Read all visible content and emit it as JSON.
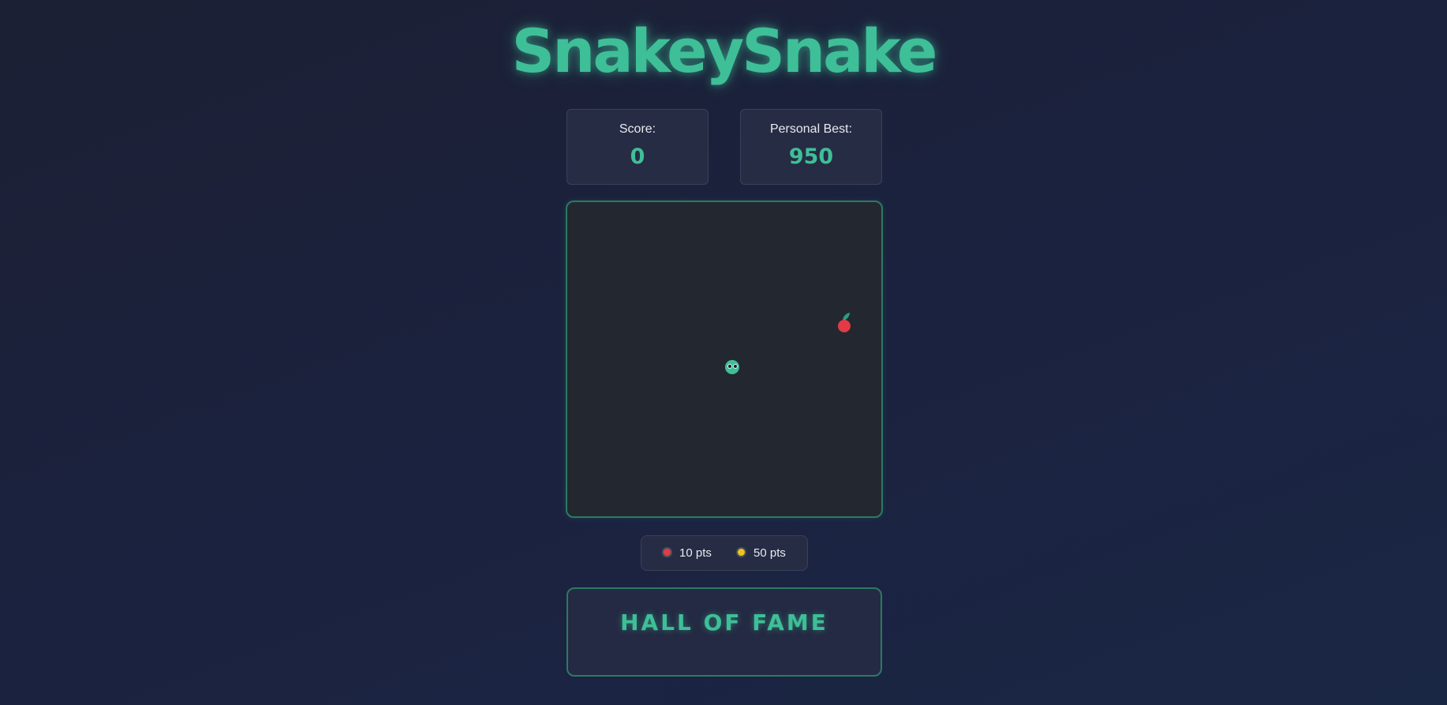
{
  "game": {
    "title": "SnakeySnake"
  },
  "scoreboard": {
    "score_label": "Score:",
    "score_value": "0",
    "best_label": "Personal Best:",
    "best_value": "950"
  },
  "board": {
    "snake_head_icon": "snake-head-icon",
    "food_icon": "apple-icon"
  },
  "legend": {
    "items": [
      {
        "icon": "red-food-dot-icon",
        "color": "#e23b45",
        "label": "10 pts"
      },
      {
        "icon": "gold-food-dot-icon",
        "color": "#f0c419",
        "label": "50 pts"
      }
    ]
  },
  "hall_of_fame": {
    "title": "HALL OF FAME"
  },
  "colors": {
    "accent": "#3ebf97",
    "background": "#1b2240",
    "board": "#232830",
    "food_red": "#e23b45",
    "food_gold": "#f0c419"
  }
}
